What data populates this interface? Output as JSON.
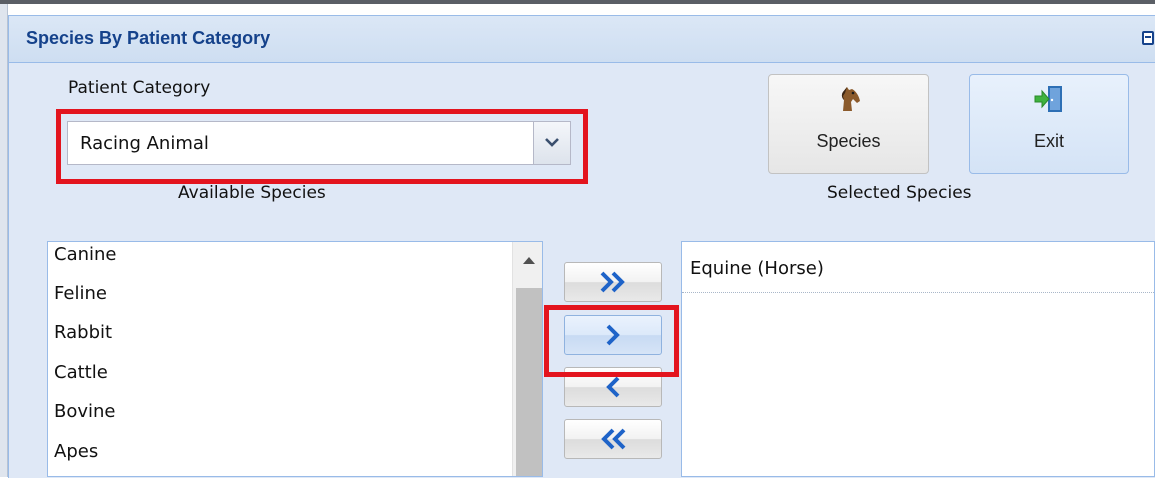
{
  "panel": {
    "title": "Species By Patient Category"
  },
  "patient_category": {
    "label": "Patient Category",
    "value": "Racing Animal"
  },
  "available_species": {
    "label": "Available Species",
    "items": [
      "Canine",
      "Feline",
      "Rabbit",
      "Cattle",
      "Bovine",
      "Apes"
    ]
  },
  "selected_species": {
    "label": "Selected Species",
    "items": [
      "Equine (Horse)"
    ]
  },
  "toolbar": {
    "species_label": "Species",
    "exit_label": "Exit"
  },
  "move_buttons": [
    "move-all-right",
    "move-right",
    "move-left",
    "move-all-left"
  ],
  "colors": {
    "panel_title": "#15428b",
    "panel_bg": "#dfe8f6",
    "highlight_box": "#e3141e",
    "arrow_blue": "#1e63c8"
  },
  "icons": [
    "horse-icon",
    "exit-door-icon",
    "chevron-down-icon",
    "double-chevron-right-icon",
    "chevron-right-icon",
    "chevron-left-icon",
    "double-chevron-left-icon",
    "scroll-up-icon"
  ]
}
